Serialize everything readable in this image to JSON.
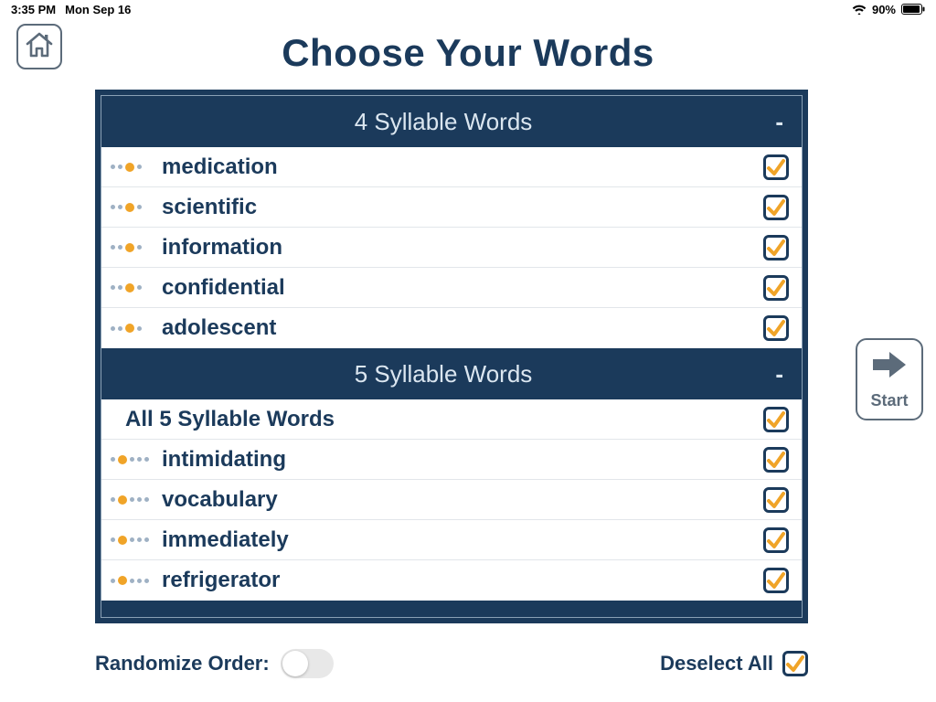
{
  "status": {
    "time": "3:35 PM",
    "date": "Mon Sep 16",
    "battery": "90%"
  },
  "title": "Choose Your Words",
  "start_label": "Start",
  "sections": [
    {
      "header": "4 Syllable Words",
      "collapse": "-",
      "items": [
        {
          "word": "medication",
          "stress": [
            0,
            0,
            1,
            0
          ],
          "checked": true
        },
        {
          "word": "scientific",
          "stress": [
            0,
            0,
            1,
            0
          ],
          "checked": true
        },
        {
          "word": "information",
          "stress": [
            0,
            0,
            1,
            0
          ],
          "checked": true
        },
        {
          "word": "confidential",
          "stress": [
            0,
            0,
            1,
            0
          ],
          "checked": true
        },
        {
          "word": "adolescent",
          "stress": [
            0,
            0,
            1,
            0
          ],
          "checked": true
        }
      ]
    },
    {
      "header": "5 Syllable Words",
      "collapse": "-",
      "all_label": "All 5 Syllable Words",
      "all_checked": true,
      "items": [
        {
          "word": "intimidating",
          "stress": [
            0,
            1,
            0,
            0,
            0
          ],
          "checked": true
        },
        {
          "word": "vocabulary",
          "stress": [
            0,
            1,
            0,
            0,
            0
          ],
          "checked": true
        },
        {
          "word": "immediately",
          "stress": [
            0,
            1,
            0,
            0,
            0
          ],
          "checked": true
        },
        {
          "word": "refrigerator",
          "stress": [
            0,
            1,
            0,
            0,
            0
          ],
          "checked": true
        }
      ]
    }
  ],
  "footer": {
    "randomize_label": "Randomize Order:",
    "randomize_on": false,
    "deselect_label": "Deselect All",
    "deselect_checked": true
  }
}
